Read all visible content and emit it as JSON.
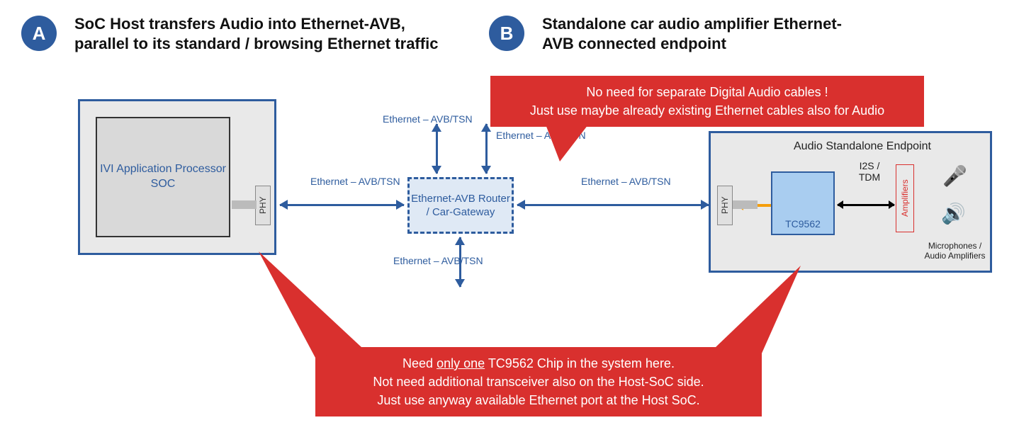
{
  "badgeA": "A",
  "badgeB": "B",
  "headingA": "SoC Host transfers Audio into Ethernet-AVB, parallel to its standard / browsing Ethernet traffic",
  "headingB": "Standalone car audio amplifier Ethernet-AVB connected endpoint",
  "ivi": {
    "label": "IVI Application Processor SOC",
    "phy": "PHY"
  },
  "router": "Ethernet-AVB Router / Car-Gateway",
  "ethLabel": "Ethernet – AVB/TSN",
  "endpoint": {
    "title": "Audio Standalone Endpoint",
    "phy": "PHY",
    "chip": "TC9562",
    "bus": "I2S / TDM",
    "amp": "Amplifiers",
    "devices": "Microphones / Audio Amplifiers"
  },
  "callout1a": "No need for separate Digital Audio cables !",
  "callout1b": "Just use maybe already existing Ethernet cables also for Audio",
  "callout2a_pre": "Need ",
  "callout2a_u": "only one",
  "callout2a_post": " TC9562 Chip in the system here.",
  "callout2b": "Not need additional transceiver also on the Host-SoC side.",
  "callout2c": "Just use anyway available Ethernet port at the Host SoC.",
  "icons": {
    "mic": "🎤",
    "speaker": "🔊"
  }
}
